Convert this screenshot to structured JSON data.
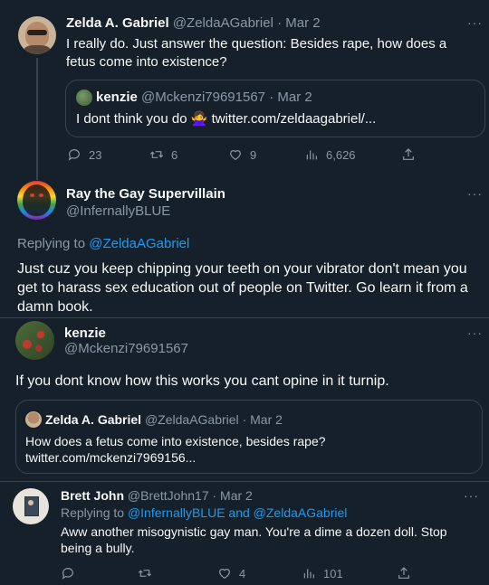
{
  "tweet1": {
    "name": "Zelda A. Gabriel",
    "handle": "@ZeldaAGabriel",
    "date": "· Mar 2",
    "text": "I really do. Just answer the question: Besides rape, how does a fetus come into existence?",
    "quote": {
      "name": "kenzie",
      "handle": "@Mckenzi79691567",
      "date": "· Mar 2",
      "text": "I dont think you do 🙅‍♀️ twitter.com/zeldaagabriel/..."
    },
    "actions": {
      "replies": "23",
      "retweets": "6",
      "likes": "9",
      "views": "6,626"
    }
  },
  "tweet2": {
    "name": "Ray the Gay Supervillain",
    "handle": "@InfernallyBLUE",
    "replying_prefix": "Replying to",
    "replying_to": "@ZeldaAGabriel",
    "text": "Just cuz you keep chipping your teeth on your vibrator don't mean you get to harass sex education out of people on Twitter. Go learn it from a damn book."
  },
  "tweet3": {
    "name": "kenzie",
    "handle": "@Mckenzi79691567",
    "text": "If you dont know how this works you cant opine in it turnip.",
    "quote": {
      "name": "Zelda A. Gabriel",
      "handle": "@ZeldaAGabriel",
      "date": "· Mar 2",
      "text": "How does a fetus come into existence, besides rape? twitter.com/mckenzi7969156..."
    }
  },
  "tweet4": {
    "name": "Brett John",
    "handle": "@BrettJohn17",
    "date": "· Mar 2",
    "replying_prefix": "Replying to",
    "replying_to": "@InfernallyBLUE and @ZeldaAGabriel",
    "text": "Aww another misogynistic gay man.  You're a dime a dozen doll.  Stop being a bully.",
    "actions": {
      "replies": "",
      "retweets": "",
      "likes": "4",
      "views": "101"
    }
  },
  "ui": {
    "more": "···"
  },
  "colors": {
    "background": "#15202b",
    "text": "#f7f9f9",
    "muted": "#8b98a5",
    "link": "#1d9bf0",
    "border": "#38444d"
  }
}
